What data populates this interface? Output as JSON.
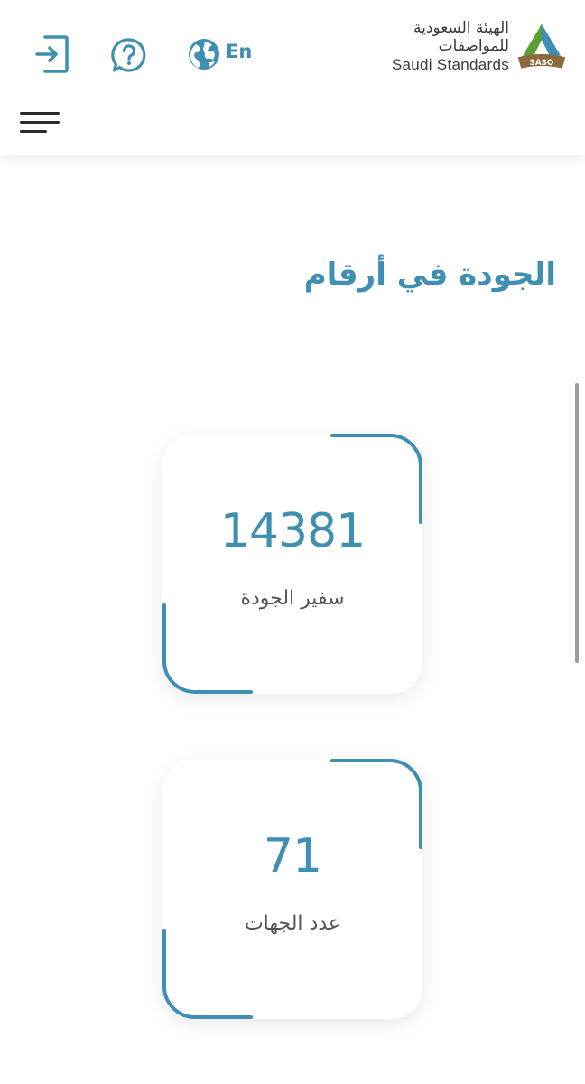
{
  "header": {
    "logo": {
      "arabic_name": "الهيئة السعودية للمواصفات",
      "english_name": "Saudi Standards",
      "emblem_text": "SASO"
    },
    "language_label": "En",
    "icons": {
      "login": "login-icon",
      "help": "help-question-icon",
      "language": "globe-icon",
      "menu": "hamburger-menu-icon"
    }
  },
  "section": {
    "title": "الجودة في أرقام"
  },
  "stats": [
    {
      "value": "14381",
      "label": "سفير الجودة"
    },
    {
      "value": "71",
      "label": "عدد الجهات"
    }
  ],
  "colors": {
    "accent": "#3f8fb2",
    "logo_green": "#5a9e3a",
    "logo_brown": "#8b6b3d",
    "logo_teal": "#3f8fb2"
  }
}
